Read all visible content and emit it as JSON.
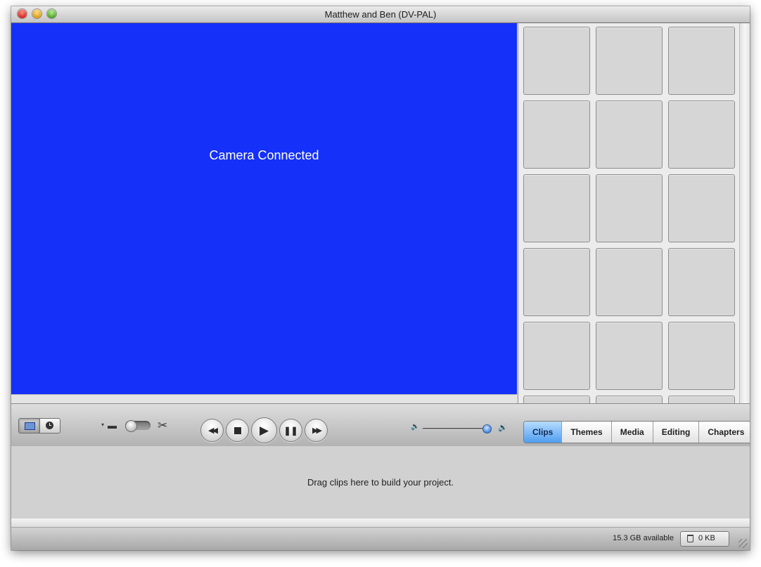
{
  "window": {
    "title": "Matthew and Ben (DV-PAL)",
    "traffic_lights": [
      "close-icon",
      "minimize-icon",
      "zoom-icon"
    ]
  },
  "viewer": {
    "message": "Camera Connected",
    "background_color": "#1530f8"
  },
  "clip_pane": {
    "slots_visible": 18,
    "columns": 3
  },
  "toolbar": {
    "view_toggle": [
      "clip-viewer-icon",
      "timeline-viewer-icon"
    ],
    "mode_switch": {
      "camera_icon": "camera-icon",
      "edit_icon": "scissors-icon",
      "arrow": "▾",
      "camera_glyph": "▬",
      "scissors_glyph": "✂"
    },
    "transport": {
      "rewind": "◀◀",
      "stop": "■",
      "play": "▶",
      "pause": "❚❚",
      "forward": "▶▶"
    },
    "volume": {
      "low_icon": "speaker-low-icon",
      "high_icon": "speaker-high-icon",
      "low_glyph": "🔈",
      "high_glyph": "🔊",
      "level": 0.95
    },
    "tabs": [
      "Clips",
      "Themes",
      "Media",
      "Editing",
      "Chapters"
    ],
    "active_tab": "Clips",
    "accent_color": "#4f9df0"
  },
  "dropzone": {
    "message": "Drag clips here to build your project."
  },
  "status": {
    "available": "15.3 GB available",
    "trash_size": "0 KB"
  }
}
